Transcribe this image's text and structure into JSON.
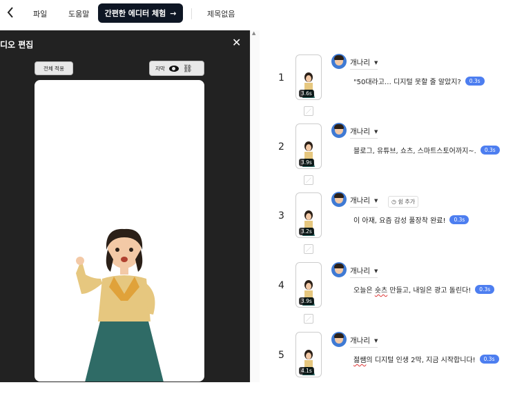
{
  "topbar": {
    "back_icon": "chevron-left-icon",
    "menu_file": "파일",
    "menu_help": "도움말",
    "try_editor": "간편한 에디터 체험",
    "try_arrow": "→",
    "doc_title": "제목없음"
  },
  "panel": {
    "title": "디오 편집",
    "close": "✕",
    "apply_all": "전체 적용",
    "subtitle_label": "자막",
    "link_glyph": "⛓"
  },
  "rows": [
    {
      "num": "1",
      "duration": "3.6s",
      "speaker": "개나리",
      "text": "\"50대라고… 디지털 못할 줄 알았지?",
      "time": "0.3s"
    },
    {
      "num": "2",
      "duration": "3.9s",
      "speaker": "개나리",
      "text": "블로그, 유튜브, 쇼츠, 스마트스토어까지~.",
      "time": "0.3s"
    },
    {
      "num": "3",
      "duration": "3.2s",
      "speaker": "개나리",
      "text": "이 아재, 요즘 감성 풀장착 완료!",
      "time": "0.3s",
      "rest_add": "쉼 추가"
    },
    {
      "num": "4",
      "duration": "3.9s",
      "speaker": "개나리",
      "text_pre": "오늘은 ",
      "text_mark": "숏츠",
      "text_post": " 만들고, 내일은 광고 돌린다!",
      "time": "0.3s"
    },
    {
      "num": "5",
      "duration": "4.1s",
      "speaker": "개나리",
      "text_mark": "젊쌤",
      "text_post": "의 디지털 인생 2막, 지금 시작합니다!",
      "time": "0.3s"
    }
  ],
  "colors": {
    "accent": "#4d7ef0",
    "dark_button": "#0e1624",
    "panel_bg": "#222222"
  }
}
